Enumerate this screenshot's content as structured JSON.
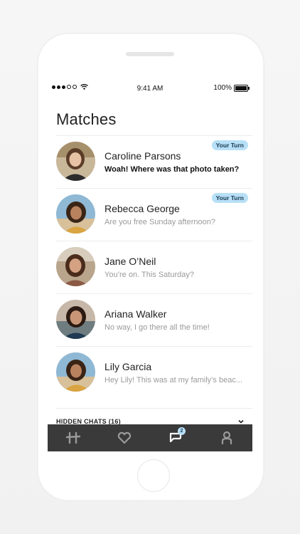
{
  "status_bar": {
    "time": "9:41 AM",
    "battery": "100%"
  },
  "header": {
    "title": "Matches"
  },
  "matches": [
    {
      "name": "Caroline Parsons",
      "preview": "Woah! Where was that photo taken?",
      "badge": "Your Turn",
      "unread": true
    },
    {
      "name": "Rebecca George",
      "preview": "Are you free Sunday afternoon?",
      "badge": "Your Turn",
      "unread": false
    },
    {
      "name": "Jane O’Neil",
      "preview": "You’re on. This Saturday?",
      "badge": "",
      "unread": false
    },
    {
      "name": "Ariana Walker",
      "preview": "No way, I go there all the time!",
      "badge": "",
      "unread": false
    },
    {
      "name": "Lily Garcia",
      "preview": "Hey Lily! This was at my family’s beac...",
      "badge": "",
      "unread": false
    }
  ],
  "hidden_chats": {
    "label": "HIDDEN CHATS (16)"
  },
  "tab_bar": {
    "tabs": [
      {
        "icon": "hinge-logo-icon"
      },
      {
        "icon": "heart-icon"
      },
      {
        "icon": "chat-icon",
        "badge": "2",
        "active": true
      },
      {
        "icon": "profile-icon"
      }
    ]
  },
  "colors": {
    "accent_badge": "#b7e0f7",
    "tab_bar_bg": "#3a3a3a"
  }
}
